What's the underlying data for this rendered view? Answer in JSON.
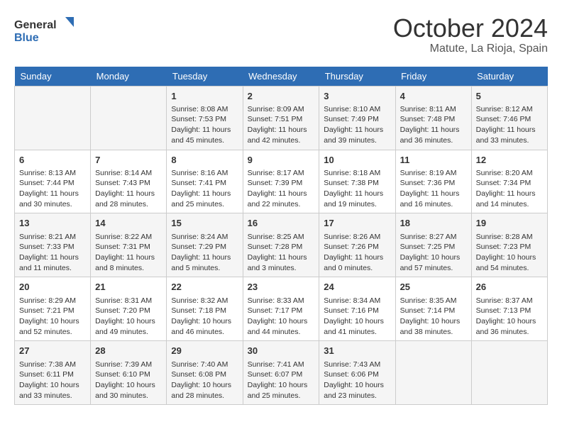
{
  "header": {
    "logo_line1": "General",
    "logo_line2": "Blue",
    "month": "October 2024",
    "location": "Matute, La Rioja, Spain"
  },
  "days_of_week": [
    "Sunday",
    "Monday",
    "Tuesday",
    "Wednesday",
    "Thursday",
    "Friday",
    "Saturday"
  ],
  "weeks": [
    [
      {
        "day": "",
        "info": ""
      },
      {
        "day": "",
        "info": ""
      },
      {
        "day": "1",
        "info": "Sunrise: 8:08 AM\nSunset: 7:53 PM\nDaylight: 11 hours and 45 minutes."
      },
      {
        "day": "2",
        "info": "Sunrise: 8:09 AM\nSunset: 7:51 PM\nDaylight: 11 hours and 42 minutes."
      },
      {
        "day": "3",
        "info": "Sunrise: 8:10 AM\nSunset: 7:49 PM\nDaylight: 11 hours and 39 minutes."
      },
      {
        "day": "4",
        "info": "Sunrise: 8:11 AM\nSunset: 7:48 PM\nDaylight: 11 hours and 36 minutes."
      },
      {
        "day": "5",
        "info": "Sunrise: 8:12 AM\nSunset: 7:46 PM\nDaylight: 11 hours and 33 minutes."
      }
    ],
    [
      {
        "day": "6",
        "info": "Sunrise: 8:13 AM\nSunset: 7:44 PM\nDaylight: 11 hours and 30 minutes."
      },
      {
        "day": "7",
        "info": "Sunrise: 8:14 AM\nSunset: 7:43 PM\nDaylight: 11 hours and 28 minutes."
      },
      {
        "day": "8",
        "info": "Sunrise: 8:16 AM\nSunset: 7:41 PM\nDaylight: 11 hours and 25 minutes."
      },
      {
        "day": "9",
        "info": "Sunrise: 8:17 AM\nSunset: 7:39 PM\nDaylight: 11 hours and 22 minutes."
      },
      {
        "day": "10",
        "info": "Sunrise: 8:18 AM\nSunset: 7:38 PM\nDaylight: 11 hours and 19 minutes."
      },
      {
        "day": "11",
        "info": "Sunrise: 8:19 AM\nSunset: 7:36 PM\nDaylight: 11 hours and 16 minutes."
      },
      {
        "day": "12",
        "info": "Sunrise: 8:20 AM\nSunset: 7:34 PM\nDaylight: 11 hours and 14 minutes."
      }
    ],
    [
      {
        "day": "13",
        "info": "Sunrise: 8:21 AM\nSunset: 7:33 PM\nDaylight: 11 hours and 11 minutes."
      },
      {
        "day": "14",
        "info": "Sunrise: 8:22 AM\nSunset: 7:31 PM\nDaylight: 11 hours and 8 minutes."
      },
      {
        "day": "15",
        "info": "Sunrise: 8:24 AM\nSunset: 7:29 PM\nDaylight: 11 hours and 5 minutes."
      },
      {
        "day": "16",
        "info": "Sunrise: 8:25 AM\nSunset: 7:28 PM\nDaylight: 11 hours and 3 minutes."
      },
      {
        "day": "17",
        "info": "Sunrise: 8:26 AM\nSunset: 7:26 PM\nDaylight: 11 hours and 0 minutes."
      },
      {
        "day": "18",
        "info": "Sunrise: 8:27 AM\nSunset: 7:25 PM\nDaylight: 10 hours and 57 minutes."
      },
      {
        "day": "19",
        "info": "Sunrise: 8:28 AM\nSunset: 7:23 PM\nDaylight: 10 hours and 54 minutes."
      }
    ],
    [
      {
        "day": "20",
        "info": "Sunrise: 8:29 AM\nSunset: 7:21 PM\nDaylight: 10 hours and 52 minutes."
      },
      {
        "day": "21",
        "info": "Sunrise: 8:31 AM\nSunset: 7:20 PM\nDaylight: 10 hours and 49 minutes."
      },
      {
        "day": "22",
        "info": "Sunrise: 8:32 AM\nSunset: 7:18 PM\nDaylight: 10 hours and 46 minutes."
      },
      {
        "day": "23",
        "info": "Sunrise: 8:33 AM\nSunset: 7:17 PM\nDaylight: 10 hours and 44 minutes."
      },
      {
        "day": "24",
        "info": "Sunrise: 8:34 AM\nSunset: 7:16 PM\nDaylight: 10 hours and 41 minutes."
      },
      {
        "day": "25",
        "info": "Sunrise: 8:35 AM\nSunset: 7:14 PM\nDaylight: 10 hours and 38 minutes."
      },
      {
        "day": "26",
        "info": "Sunrise: 8:37 AM\nSunset: 7:13 PM\nDaylight: 10 hours and 36 minutes."
      }
    ],
    [
      {
        "day": "27",
        "info": "Sunrise: 7:38 AM\nSunset: 6:11 PM\nDaylight: 10 hours and 33 minutes."
      },
      {
        "day": "28",
        "info": "Sunrise: 7:39 AM\nSunset: 6:10 PM\nDaylight: 10 hours and 30 minutes."
      },
      {
        "day": "29",
        "info": "Sunrise: 7:40 AM\nSunset: 6:08 PM\nDaylight: 10 hours and 28 minutes."
      },
      {
        "day": "30",
        "info": "Sunrise: 7:41 AM\nSunset: 6:07 PM\nDaylight: 10 hours and 25 minutes."
      },
      {
        "day": "31",
        "info": "Sunrise: 7:43 AM\nSunset: 6:06 PM\nDaylight: 10 hours and 23 minutes."
      },
      {
        "day": "",
        "info": ""
      },
      {
        "day": "",
        "info": ""
      }
    ]
  ]
}
